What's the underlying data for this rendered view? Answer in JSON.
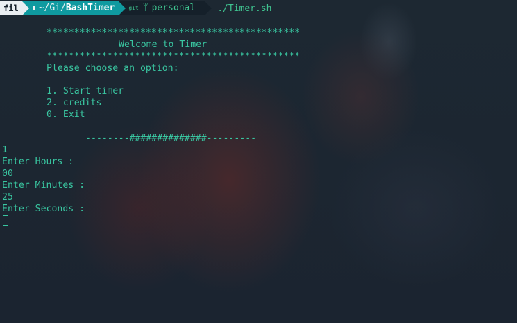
{
  "prompt": {
    "os_label": "fil",
    "folder_icon": "folder-icon",
    "dir_prefix": "~/Gi/",
    "dir_name": "BashTimer",
    "git_label": "git",
    "branch_symbol": "ᛘ",
    "branch": "personal",
    "command": "./Timer.sh"
  },
  "output": {
    "stars_top": "**********************************************",
    "welcome": "Welcome to Timer",
    "stars_bottom": "**********************************************",
    "choose": "Please choose an option:",
    "options": [
      "1. Start timer",
      "2. credits",
      "0. Exit"
    ],
    "divider": "--------##############---------"
  },
  "session": {
    "choice": "1",
    "hours_prompt": "Enter Hours :",
    "hours_value": "00",
    "minutes_prompt": "Enter Minutes :",
    "minutes_value": "25",
    "seconds_prompt": "Enter Seconds :"
  },
  "colors": {
    "text": "#39c5a0",
    "background": "#1c2731",
    "dir_segment": "#0f9aa0",
    "os_segment": "#e9eef2"
  }
}
